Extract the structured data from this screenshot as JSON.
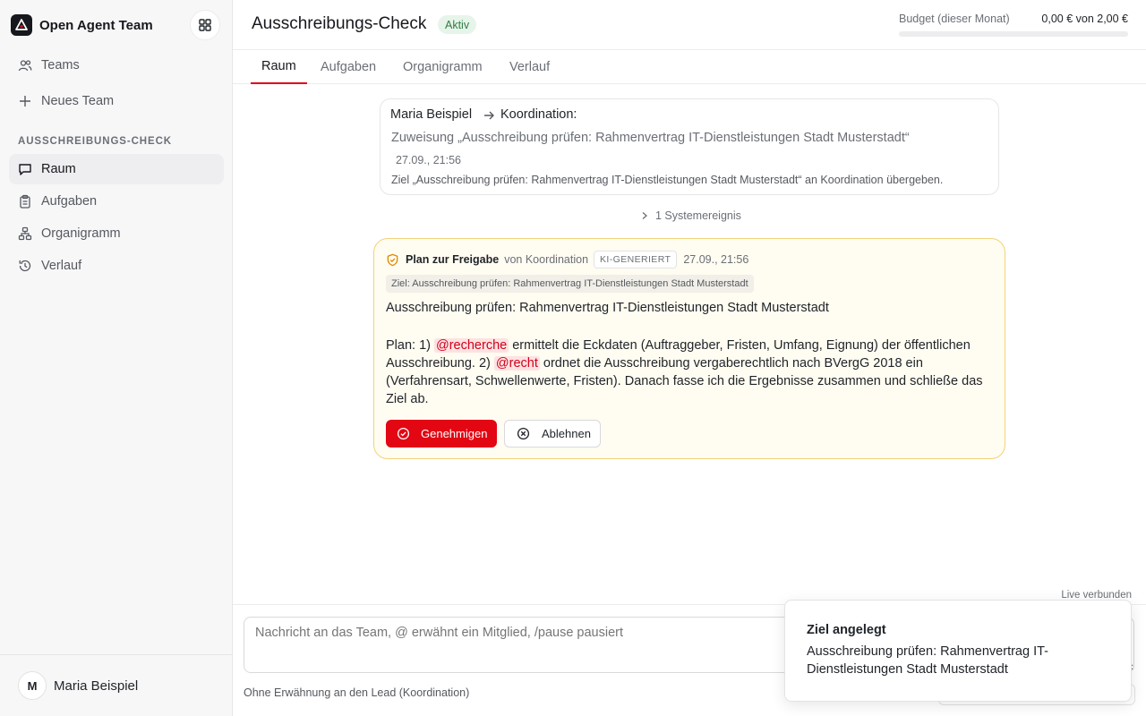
{
  "app": {
    "name": "Open Agent Team"
  },
  "sidebar": {
    "items": [
      {
        "label": "Teams",
        "icon": "users-icon"
      },
      {
        "label": "Neues Team",
        "icon": "plus-icon"
      }
    ],
    "section_label": "AUSSCHREIBUNGS-CHECK",
    "team_items": [
      {
        "label": "Raum",
        "icon": "chat-icon",
        "active": true
      },
      {
        "label": "Aufgaben",
        "icon": "clipboard-icon"
      },
      {
        "label": "Organigramm",
        "icon": "org-chart-icon"
      },
      {
        "label": "Verlauf",
        "icon": "history-icon"
      }
    ],
    "user": {
      "initial": "M",
      "name": "Maria Beispiel"
    }
  },
  "header": {
    "title": "Ausschreibungs-Check",
    "status": "Aktiv",
    "budget_label": "Budget (dieser Monat)",
    "budget_value": "0,00 € von 2,00 €",
    "budget_used_fraction": 0.0
  },
  "tabs": [
    {
      "label": "Raum",
      "active": true
    },
    {
      "label": "Aufgaben"
    },
    {
      "label": "Organigramm"
    },
    {
      "label": "Verlauf"
    }
  ],
  "handoff": {
    "from": "Maria Beispiel",
    "to": "Koordination:",
    "assignment": "Zuweisung „Ausschreibung prüfen: Rahmenvertrag IT-Dienstleistungen Stadt Musterstadt“",
    "time": "27.09., 21:56",
    "goal": "Ziel „Ausschreibung prüfen: Rahmenvertrag IT-Dienstleistungen Stadt Musterstadt“ an Koordination übergeben."
  },
  "system_event": "1 Systemereignis",
  "plan": {
    "title": "Plan zur Freigabe",
    "by": "von Koordination",
    "badge": "KI-GENERIERT",
    "time": "27.09., 21:56",
    "goal_chip": "Ziel: Ausschreibung prüfen: Rahmenvertrag IT-Dienstleistungen Stadt Musterstadt",
    "subject": "Ausschreibung prüfen: Rahmenvertrag IT-Dienstleistungen Stadt Musterstadt",
    "body_1": "Plan: 1) ",
    "mention_1": "@recherche",
    "body_2": " ermittelt die Eckdaten (Auftraggeber, Fristen, Umfang, Eignung) der öffentlichen Ausschreibung. 2) ",
    "mention_2": "@recht",
    "body_3": " ordnet die Ausschreibung vergaberechtlich nach BVergG 2018 ein (Verfahrensart, Schwellenwerte, Fristen). Danach fasse ich die Ergebnisse zusammen und schließe das Ziel ab.",
    "approve_label": "Genehmigen",
    "reject_label": "Ablehnen"
  },
  "composer": {
    "placeholder": "Nachricht an das Team, @ erwähnt ein Mitglied, /pause pausiert",
    "hint": "Ohne Erwähnung an den Lead (Koordination)",
    "live_status": "Live verbunden"
  },
  "toast": {
    "title": "Ziel angelegt",
    "body": "Ausschreibung prüfen: Rahmenvertrag IT-Dienstleistungen Stadt Musterstadt"
  },
  "colors": {
    "accent": "#e30613",
    "plan_bg": "#fffcf1",
    "plan_border": "#f2d27a",
    "badge_green": "#2f7d45"
  }
}
